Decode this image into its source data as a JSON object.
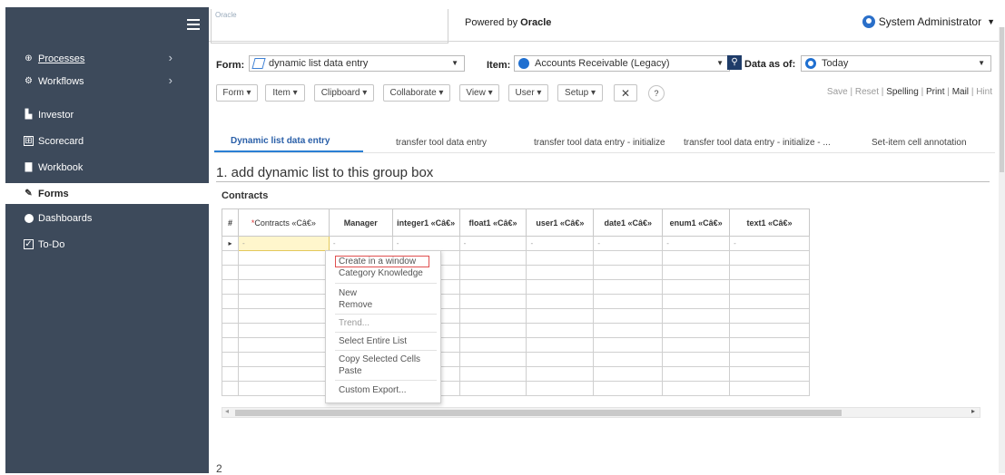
{
  "header": {
    "logo_alt": "Oracle",
    "powered_prefix": "Powered by ",
    "powered_brand": "Oracle",
    "user": "System Administrator"
  },
  "sidebar": {
    "items": [
      {
        "label": "Processes",
        "icon": "globe-icon"
      },
      {
        "label": "Workflows",
        "icon": "workflow-icon"
      },
      {
        "label": "Investor",
        "icon": "investor-icon"
      },
      {
        "label": "Scorecard",
        "icon": "scorecard-icon"
      },
      {
        "label": "Workbook",
        "icon": "workbook-icon"
      },
      {
        "label": "Forms",
        "icon": "pencil-icon"
      },
      {
        "label": "Dashboards",
        "icon": "dashboard-icon"
      },
      {
        "label": "To-Do",
        "icon": "checkbox-icon"
      }
    ]
  },
  "form_row": {
    "form_label": "Form:",
    "form_value": "dynamic list data entry",
    "item_label": "Item:",
    "item_value": "Accounts Receivable (Legacy)",
    "data_as_of_label": "Data as of:",
    "data_as_of_value": "Today"
  },
  "toolbar": {
    "form": "Form ▾",
    "item": "Item ▾",
    "clipboard": "Clipboard ▾",
    "collaborate": "Collaborate ▾",
    "view": "View ▾",
    "user": "User ▾",
    "setup": "Setup ▾",
    "tools_icon": "✕",
    "help_icon": "?"
  },
  "actions": {
    "save": "Save",
    "reset": "Reset",
    "spelling": "Spelling",
    "print": "Print",
    "mail": "Mail",
    "hint": "Hint",
    "sep": "|"
  },
  "tabs": [
    "Dynamic list data entry",
    "transfer tool data entry",
    "transfer tool data entry - initialize",
    "transfer tool data entry - initialize - ...",
    "Set-item cell annotation"
  ],
  "section": {
    "title": "1. add dynamic list to this group box",
    "group": "Contracts",
    "next_number": "2"
  },
  "grid": {
    "row_header": "#",
    "columns": [
      {
        "label": "Contracts «Câ€»",
        "required": true
      },
      {
        "label": "Manager"
      },
      {
        "label": "integer1 «Câ€»"
      },
      {
        "label": "float1 «Câ€»"
      },
      {
        "label": "user1 «Câ€»"
      },
      {
        "label": "date1 «Câ€»"
      },
      {
        "label": "enum1 «Câ€»"
      },
      {
        "label": "text1 «Câ€»"
      }
    ],
    "required_mark": "*",
    "row_pointer": "▸",
    "dash": "-",
    "empty_rows": 10
  },
  "context_menu": {
    "items": [
      "Create in a window",
      "Category Knowledge",
      "New",
      "Remove",
      "Trend...",
      "Select Entire List",
      "Copy Selected Cells",
      "Paste",
      "Custom Export..."
    ]
  },
  "colors": {
    "sidebar_bg": "#3d4a5b",
    "accent": "#2a7fd4",
    "highlight": "#e05050"
  }
}
